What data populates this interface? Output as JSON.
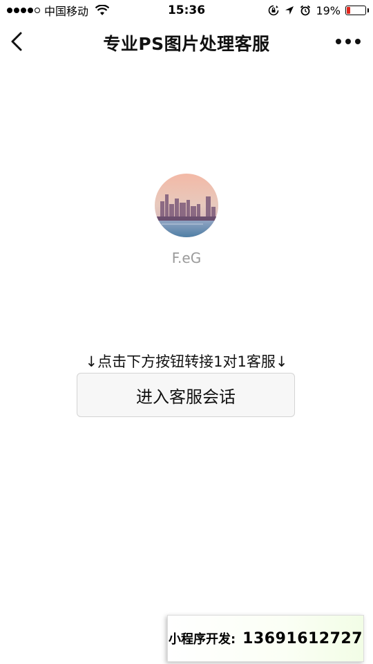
{
  "status_bar": {
    "carrier": "中国移动",
    "time": "15:36",
    "battery_percent": "19%",
    "battery_level": 0.19,
    "battery_color": "#e0271d",
    "signal_bars_filled": 4,
    "icons": [
      "wifi-icon",
      "rotation-lock-icon",
      "location-arrow-icon",
      "alarm-icon",
      "battery-icon"
    ]
  },
  "nav": {
    "title": "专业PS图片处理客服",
    "back_icon": "chevron-left-icon",
    "more_icon": "more-dots-icon"
  },
  "profile": {
    "avatar": "city-skyline-avatar",
    "name": "F.eG"
  },
  "hint": "↓点击下方按钮转接1对1客服↓",
  "enter_button": "进入客服会话",
  "dev_banner": {
    "label": "小程序开发:",
    "phone": "13691612727"
  }
}
